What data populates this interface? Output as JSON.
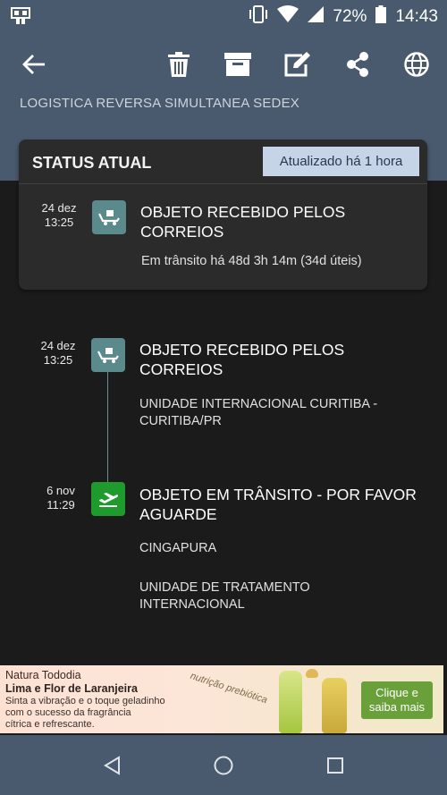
{
  "status_bar": {
    "battery_percent": "72%",
    "time": "14:43"
  },
  "toolbar": {
    "icons": [
      "back-arrow-icon",
      "trash-icon",
      "archive-icon",
      "edit-icon",
      "share-icon",
      "globe-icon"
    ],
    "subtitle": "LOGISTICA REVERSA SIMULTANEA SEDEX"
  },
  "status_card": {
    "title": "STATUS ATUAL",
    "badge": "Atualizado há 1 hora",
    "event": {
      "date": "24 dez",
      "time": "13:25",
      "title_line1": "OBJETO RECEBIDO PELOS",
      "title_line2": "CORREIOS",
      "detail": "Em trânsito há 48d 3h 14m (34d úteis)"
    }
  },
  "timeline": [
    {
      "date": "24 dez",
      "time": "13:25",
      "icon": "truck-box-icon",
      "title_line1": "OBJETO RECEBIDO PELOS",
      "title_line2": "CORREIOS",
      "lines": [
        "UNIDADE INTERNACIONAL CURITIBA -",
        "CURITIBA/PR"
      ]
    },
    {
      "date": "6 nov",
      "time": "11:29",
      "icon": "plane-takeoff-icon",
      "title_line1": "OBJETO EM TRÂNSITO - POR FAVOR",
      "title_line2": "AGUARDE",
      "lines": [
        "CINGAPURA",
        "UNIDADE DE TRATAMENTO",
        "INTERNACIONAL"
      ]
    }
  ],
  "ad": {
    "brand": "Natura Tododia",
    "product": "Lima e Flor de Laranjeira",
    "desc_line1": "Sinta a vibração e o toque geladinho",
    "desc_line2": "com o sucesso  da fragrância",
    "desc_line3": "cítrica e refrescante.",
    "tag": "nutrição prebiótica",
    "cta_line1": "Clique e",
    "cta_line2": "saiba mais"
  },
  "colors": {
    "header": "#4a5a6e",
    "background": "#1b1b1c",
    "card": "#2b2b2c",
    "badge": "#c6d4e8",
    "icon_received": "#5a8a8c",
    "icon_transit": "#1f9b2e"
  },
  "navbar": {
    "icons": [
      "nav-back-icon",
      "nav-home-icon",
      "nav-recents-icon"
    ]
  }
}
